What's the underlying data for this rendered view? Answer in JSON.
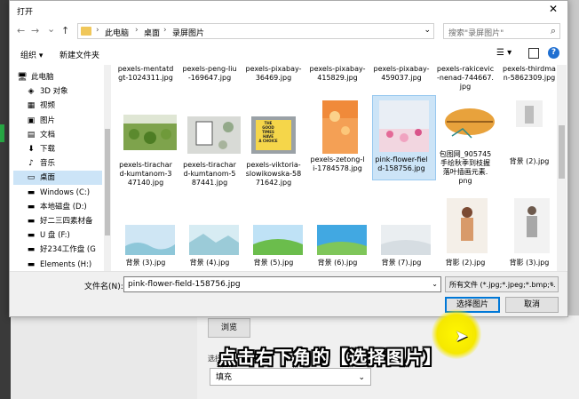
{
  "dialog": {
    "title": "打开",
    "close": "✕"
  },
  "nav": {
    "back": "←",
    "forward": "→",
    "recent": "⌄",
    "up": "↑",
    "breadcrumbs": [
      "此电脑",
      "桌面",
      "录屏图片"
    ],
    "search_placeholder": "搜索\"录屏图片\""
  },
  "toolbar": {
    "organize": "组织 ▾",
    "new_folder": "新建文件夹"
  },
  "sidebar": {
    "items": [
      {
        "icon": "computer-icon",
        "glyph": "🖥",
        "label": "此电脑",
        "root": true
      },
      {
        "icon": "3d-objects-icon",
        "glyph": "◈",
        "label": "3D 对象"
      },
      {
        "icon": "video-icon",
        "glyph": "▦",
        "label": "视频"
      },
      {
        "icon": "pictures-icon",
        "glyph": "▣",
        "label": "图片"
      },
      {
        "icon": "documents-icon",
        "glyph": "▤",
        "label": "文档"
      },
      {
        "icon": "downloads-icon",
        "glyph": "⬇",
        "label": "下载"
      },
      {
        "icon": "music-icon",
        "glyph": "♪",
        "label": "音乐"
      },
      {
        "icon": "desktop-icon",
        "glyph": "▭",
        "label": "桌面",
        "selected": true
      },
      {
        "icon": "windows-drive-icon",
        "glyph": "▬",
        "label": "Windows  (C:)"
      },
      {
        "icon": "drive-icon",
        "glyph": "▬",
        "label": "本地磁盘 (D:)"
      },
      {
        "icon": "drive-icon",
        "glyph": "▬",
        "label": "好二三四素材备"
      },
      {
        "icon": "drive-icon",
        "glyph": "▬",
        "label": "U 盘 (F:)"
      },
      {
        "icon": "drive-icon",
        "glyph": "▬",
        "label": "好234工作盘 (G"
      },
      {
        "icon": "drive-icon",
        "glyph": "▬",
        "label": "Elements (H:)"
      }
    ]
  },
  "files": {
    "row1": [
      "pexels-mentatd\ngt-1024311.jpg",
      "pexels-peng-liu\n-169647.jpg",
      "pexels-pixabay-\n36469.jpg",
      "pexels-pixabay-\n415829.jpg",
      "pexels-pixabay-\n459037.jpg",
      "pexels-rakicevic\n-nenad-744667.\njpg",
      "pexels-thirdma\nn-5862309.jpg"
    ],
    "row2": [
      "pexels-tirachar\nd-kumtanom-3\n47140.jpg",
      "pexels-tirachar\nd-kumtanom-5\n87441.jpg",
      "pexels-viktoria-\nslowikowska-58\n71642.jpg",
      "pexels-zetong-l\ni-1784578.jpg",
      "pink-flower-fiel\nd-158756.jpg",
      "包图网_905745\n手绘秋季到枝握\n落叶插画元素.\npng",
      "背景 (2).jpg"
    ],
    "row3": [
      "背景 (3).jpg",
      "背景 (4).jpg",
      "背景 (5).jpg",
      "背景 (6).jpg",
      "背景 (7).jpg",
      "背影 (2).jpg",
      "背影 (3).jpg"
    ],
    "poster_text": "THE\nGOOD\nTIMES\nHAVE\nA CHOICE"
  },
  "bottom": {
    "filename_label": "文件名(N):",
    "filename_value": "pink-flower-field-158756.jpg",
    "filetype_value": "所有文件 (*.jpg;*.jpeg;*.bmp;*.",
    "open_button": "选择图片",
    "cancel_button": "取消"
  },
  "background": {
    "browse_button": "浏览",
    "select_value": "填充",
    "under_label": "选择",
    "subtitle": "点击右下角的【选择图片】"
  }
}
